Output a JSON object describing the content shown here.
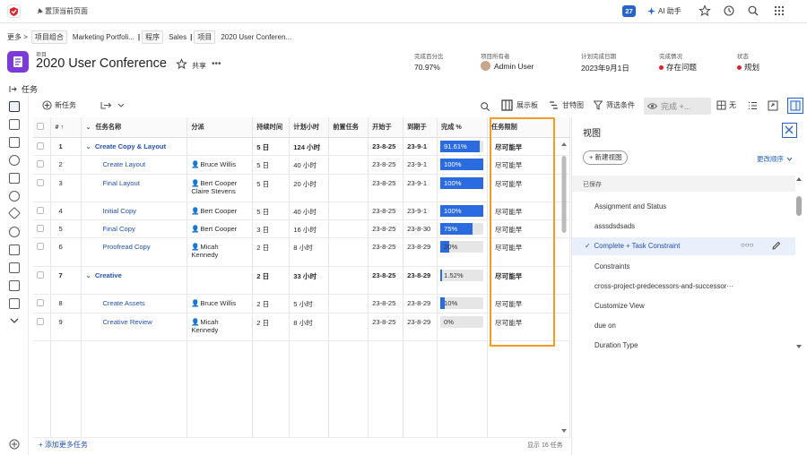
{
  "topbar": {
    "pin_label": "置顶当前页面",
    "calendar_badge": "27",
    "ai_label": "AI 助手"
  },
  "breadcrumb": {
    "more": "更多 >",
    "items": [
      {
        "type": "项目组合",
        "name": "Marketing Portfoli..."
      },
      {
        "type": "程序",
        "name": "Sales"
      },
      {
        "type": "项目",
        "name": "2020 User Conferen..."
      }
    ]
  },
  "project": {
    "kind": "项目",
    "title": "2020 User Conference",
    "share_label": "共享",
    "more_label": "•••",
    "meta": [
      {
        "label": "完成百分比",
        "value": "70.97%"
      },
      {
        "label": "项目所有者",
        "value": "Admin User"
      },
      {
        "label": "计划完成日期",
        "value": "2023年9月1日"
      },
      {
        "label": "完成情况",
        "value": "存在问题"
      },
      {
        "label": "状态",
        "value": "规划"
      }
    ]
  },
  "tasks_label": "任务",
  "toolbar": {
    "new_task": "新任务",
    "display": "展示板",
    "gantt": "甘特图",
    "filter": "筛选条件",
    "view": "完成 +...",
    "group": "无"
  },
  "columns": [
    "#",
    "任务名称",
    "分派",
    "持续时间",
    "计划小时",
    "前置任务",
    "开始于",
    "到期于",
    "完成 %",
    "任务限制"
  ],
  "rows": [
    {
      "num": "1",
      "name": "Create Copy & Layout",
      "parent": true,
      "assign": [
        "",
        ""
      ],
      "duration": "5 日",
      "hours": "124 小时",
      "pred": "",
      "start": "23-8-25",
      "due": "23-9-1",
      "pct": 91.61,
      "pct_label": "91.61%",
      "constraint": "尽可能早"
    },
    {
      "num": "2",
      "name": "Create Layout",
      "parent": false,
      "assign": [
        "Bruce Willis",
        ""
      ],
      "duration": "5 日",
      "hours": "40 小时",
      "pred": "",
      "start": "23-8-25",
      "due": "23-9-1",
      "pct": 100,
      "pct_label": "100%",
      "constraint": "尽可能早"
    },
    {
      "num": "3",
      "name": "Final Layout",
      "parent": false,
      "assign": [
        "Bert Cooper",
        "Claire Stevens"
      ],
      "duration": "5 日",
      "hours": "20 小时",
      "pred": "",
      "start": "23-8-25",
      "due": "23-9-1",
      "pct": 100,
      "pct_label": "100%",
      "constraint": "尽可能早"
    },
    {
      "num": "4",
      "name": "Initial Copy",
      "parent": false,
      "assign": [
        "Bert Cooper",
        ""
      ],
      "duration": "5 日",
      "hours": "40 小时",
      "pred": "",
      "start": "23-8-25",
      "due": "23-9-1",
      "pct": 100,
      "pct_label": "100%",
      "constraint": "尽可能早"
    },
    {
      "num": "5",
      "name": "Final Copy",
      "parent": false,
      "assign": [
        "Bert Cooper",
        ""
      ],
      "duration": "3 日",
      "hours": "16 小时",
      "pred": "",
      "start": "23-8-25",
      "due": "23-8-30",
      "pct": 75,
      "pct_label": "75%",
      "constraint": "尽可能早"
    },
    {
      "num": "6",
      "name": "Proofread Copy",
      "parent": false,
      "assign": [
        "Micah",
        "Kennedy"
      ],
      "duration": "2 日",
      "hours": "8 小时",
      "pred": "",
      "start": "23-8-25",
      "due": "23-8-29",
      "pct": 20,
      "pct_label": "20%",
      "constraint": "尽可能早"
    },
    {
      "num": "7",
      "name": "Creative",
      "parent": true,
      "assign": [
        "",
        ""
      ],
      "duration": "2 日",
      "hours": "33 小时",
      "pred": "",
      "start": "23-8-25",
      "due": "23-8-29",
      "pct": 1.52,
      "pct_label": "1.52%",
      "constraint": "尽可能早"
    },
    {
      "num": "8",
      "name": "Create Assets",
      "parent": false,
      "assign": [
        "Bruce Willis",
        ""
      ],
      "duration": "2 日",
      "hours": "5 小时",
      "pred": "",
      "start": "23-8-25",
      "due": "23-8-29",
      "pct": 10,
      "pct_label": "10%",
      "constraint": "尽可能早"
    },
    {
      "num": "9",
      "name": "Creative Review",
      "parent": false,
      "assign": [
        "Micah",
        "Kennedy"
      ],
      "duration": "2 日",
      "hours": "8 小时",
      "pred": "",
      "start": "23-8-25",
      "due": "23-8-29",
      "pct": 0,
      "pct_label": "0%",
      "constraint": "尽可能早"
    }
  ],
  "footer": {
    "add_more": "+ 添加更多任务",
    "count": "显示 16 任务"
  },
  "panel": {
    "title": "视图",
    "new_view": "+ 新建视图",
    "sort_by": "更改顺序",
    "saved_label": "已保存",
    "views": [
      {
        "name": "Assignment and Status",
        "selected": false
      },
      {
        "name": "asssdsdsads",
        "selected": false
      },
      {
        "name": "Complete + Task Constraint",
        "selected": true
      },
      {
        "name": "Constraints",
        "selected": false
      },
      {
        "name": "cross-project-predecessors-and-successor···",
        "selected": false
      },
      {
        "name": "Customize View",
        "selected": false
      },
      {
        "name": "due on",
        "selected": false
      },
      {
        "name": "Duration Type",
        "selected": false
      }
    ]
  },
  "colors": {
    "accent": "#2664c9",
    "project_icon": "#7c3bd6",
    "progress": "#2a6be0",
    "highlight": "#f59b23",
    "status_red": "#e0202e"
  }
}
